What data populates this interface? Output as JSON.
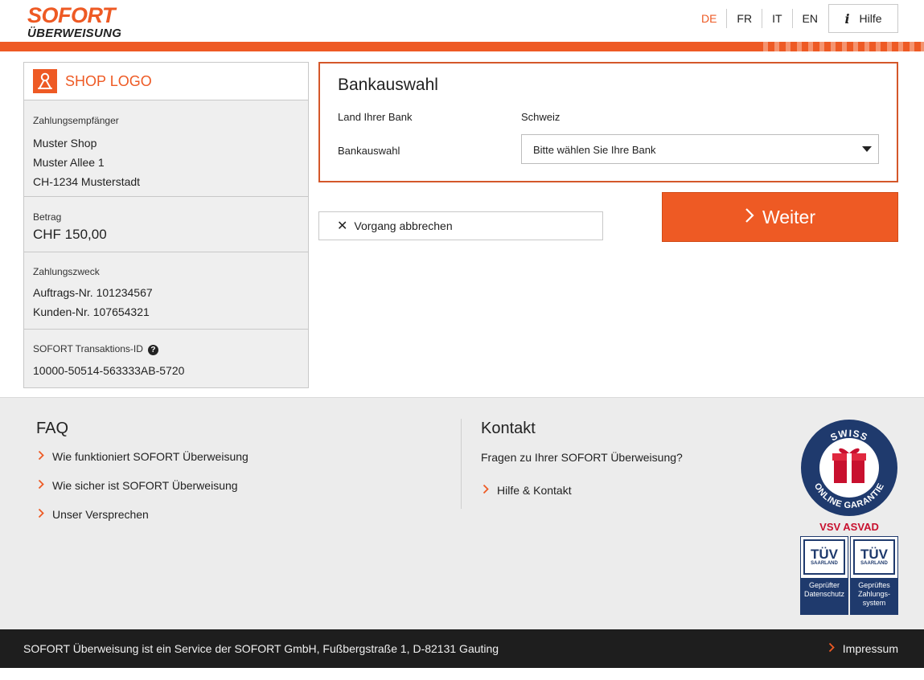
{
  "header": {
    "brand_name": "SOFORT",
    "brand_sub": "ÜBERWEISUNG",
    "languages": [
      {
        "code": "DE",
        "active": true
      },
      {
        "code": "FR",
        "active": false
      },
      {
        "code": "IT",
        "active": false
      },
      {
        "code": "EN",
        "active": false
      }
    ],
    "help_label": "Hilfe",
    "help_icon": "i"
  },
  "shop": {
    "logo_label": "SHOP LOGO"
  },
  "payee": {
    "label": "Zahlungsempfänger",
    "name": "Muster Shop",
    "street": "Muster Allee 1",
    "city": "CH-1234 Musterstadt"
  },
  "amount": {
    "label": "Betrag",
    "value": "CHF 150,00"
  },
  "purpose": {
    "label": "Zahlungszweck",
    "line1": "Auftrags-Nr. 101234567",
    "line2": "Kunden-Nr. 107654321"
  },
  "transaction": {
    "label": "SOFORT Transaktions-ID",
    "help_icon": "?",
    "value": "10000-50514-563333AB-5720"
  },
  "bank_selection": {
    "title": "Bankauswahl",
    "country_label": "Land Ihrer Bank",
    "country_value": "Schweiz",
    "bank_label": "Bankauswahl",
    "bank_placeholder": "Bitte wählen Sie Ihre Bank"
  },
  "actions": {
    "next_label": "Weiter",
    "cancel_label": "Vorgang abbrechen",
    "chevron": "›",
    "cancel_icon": "✕"
  },
  "faq": {
    "title": "FAQ",
    "links": [
      "Wie funktioniert SOFORT Überweisung",
      "Wie sicher ist SOFORT Überweisung",
      "Unser Versprechen"
    ]
  },
  "contact": {
    "title": "Kontakt",
    "question": "Fragen zu Ihrer SOFORT Überweisung?",
    "link": "Hilfe & Kontakt"
  },
  "badges": {
    "swiss_top": "SWISS",
    "swiss_bottom": "ONLINE GARANTIE",
    "vsv": "VSV ASVAD",
    "tuv1_brand": "TÜV",
    "tuv1_sub": "SAARLAND",
    "tuv1_text": "Geprüfter Datenschutz",
    "tuv2_brand": "TÜV",
    "tuv2_sub": "SAARLAND",
    "tuv2_text": "Geprüftes Zahlungs-system"
  },
  "bottom_bar": {
    "company_text": "SOFORT Überweisung ist ein Service der SOFORT GmbH, Fußbergstraße 1, D-82131 Gauting",
    "impressum": "Impressum"
  },
  "colors": {
    "brand_orange": "#ee5a24",
    "dark": "#1e1e1e",
    "tuv_blue": "#1f3a6d",
    "swiss_red": "#c8102e"
  }
}
